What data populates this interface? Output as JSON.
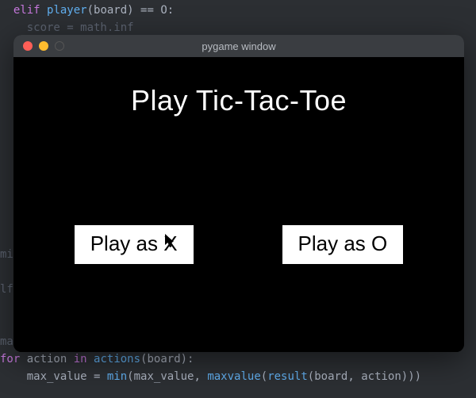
{
  "editor": {
    "lines": [
      {
        "indent": 2,
        "tokens": [
          {
            "t": "elif ",
            "c": "kw"
          },
          {
            "t": "player",
            "c": "fn"
          },
          {
            "t": "(board) ",
            "c": "par"
          },
          {
            "t": "== ",
            "c": "op"
          },
          {
            "t": "O:",
            "c": "var"
          }
        ]
      },
      {
        "indent": 4,
        "tokens": [
          {
            "t": "score = math.inf",
            "c": "grey"
          }
        ]
      },
      {
        "indent": 0,
        "tokens": [
          {
            "t": "",
            "c": "var"
          }
        ]
      },
      {
        "indent": 0,
        "tokens": [
          {
            "t": "",
            "c": "var"
          }
        ]
      },
      {
        "indent": 0,
        "tokens": [
          {
            "t": "",
            "c": "var"
          }
        ]
      },
      {
        "indent": 0,
        "tokens": [
          {
            "t": "",
            "c": "var"
          }
        ]
      },
      {
        "indent": 0,
        "tokens": [
          {
            "t": "",
            "c": "var"
          }
        ]
      },
      {
        "indent": 0,
        "tokens": [
          {
            "t": "",
            "c": "var"
          }
        ]
      },
      {
        "indent": 0,
        "tokens": [
          {
            "t": "",
            "c": "var"
          }
        ]
      },
      {
        "indent": 0,
        "tokens": [
          {
            "t": "",
            "c": "var"
          }
        ]
      },
      {
        "indent": 0,
        "tokens": [
          {
            "t": "",
            "c": "var"
          }
        ]
      },
      {
        "indent": 0,
        "tokens": [
          {
            "t": "",
            "c": "var"
          }
        ]
      },
      {
        "indent": 0,
        "tokens": [
          {
            "t": "",
            "c": "var"
          }
        ]
      },
      {
        "indent": 0,
        "tokens": [
          {
            "t": "",
            "c": "var"
          }
        ]
      },
      {
        "indent": 0,
        "tokens": [
          {
            "t": "min",
            "c": "grey"
          }
        ]
      },
      {
        "indent": 0,
        "tokens": [
          {
            "t": "",
            "c": "var"
          }
        ]
      },
      {
        "indent": 0,
        "tokens": [
          {
            "t": "lf",
            "c": "grey"
          }
        ]
      },
      {
        "indent": 0,
        "tokens": [
          {
            "t": "",
            "c": "var"
          }
        ]
      },
      {
        "indent": 0,
        "tokens": [
          {
            "t": "",
            "c": "var"
          }
        ]
      },
      {
        "indent": 0,
        "tokens": [
          {
            "t": "max_value = math.inf",
            "c": "grey"
          }
        ]
      },
      {
        "indent": 0,
        "tokens": [
          {
            "t": "for ",
            "c": "for"
          },
          {
            "t": "action ",
            "c": "var"
          },
          {
            "t": "in ",
            "c": "for"
          },
          {
            "t": "actions",
            "c": "fn"
          },
          {
            "t": "(board):",
            "c": "par"
          }
        ]
      },
      {
        "indent": 4,
        "tokens": [
          {
            "t": "max_value = ",
            "c": "var"
          },
          {
            "t": "min",
            "c": "fn"
          },
          {
            "t": "(max_value, ",
            "c": "par"
          },
          {
            "t": "maxvalue",
            "c": "fn"
          },
          {
            "t": "(",
            "c": "par"
          },
          {
            "t": "result",
            "c": "fn"
          },
          {
            "t": "(board, action)))",
            "c": "par"
          }
        ]
      }
    ]
  },
  "window": {
    "title": "pygame window"
  },
  "game": {
    "title": "Play Tic-Tac-Toe",
    "buttons": {
      "play_x": "Play as X",
      "play_o": "Play as O"
    }
  }
}
